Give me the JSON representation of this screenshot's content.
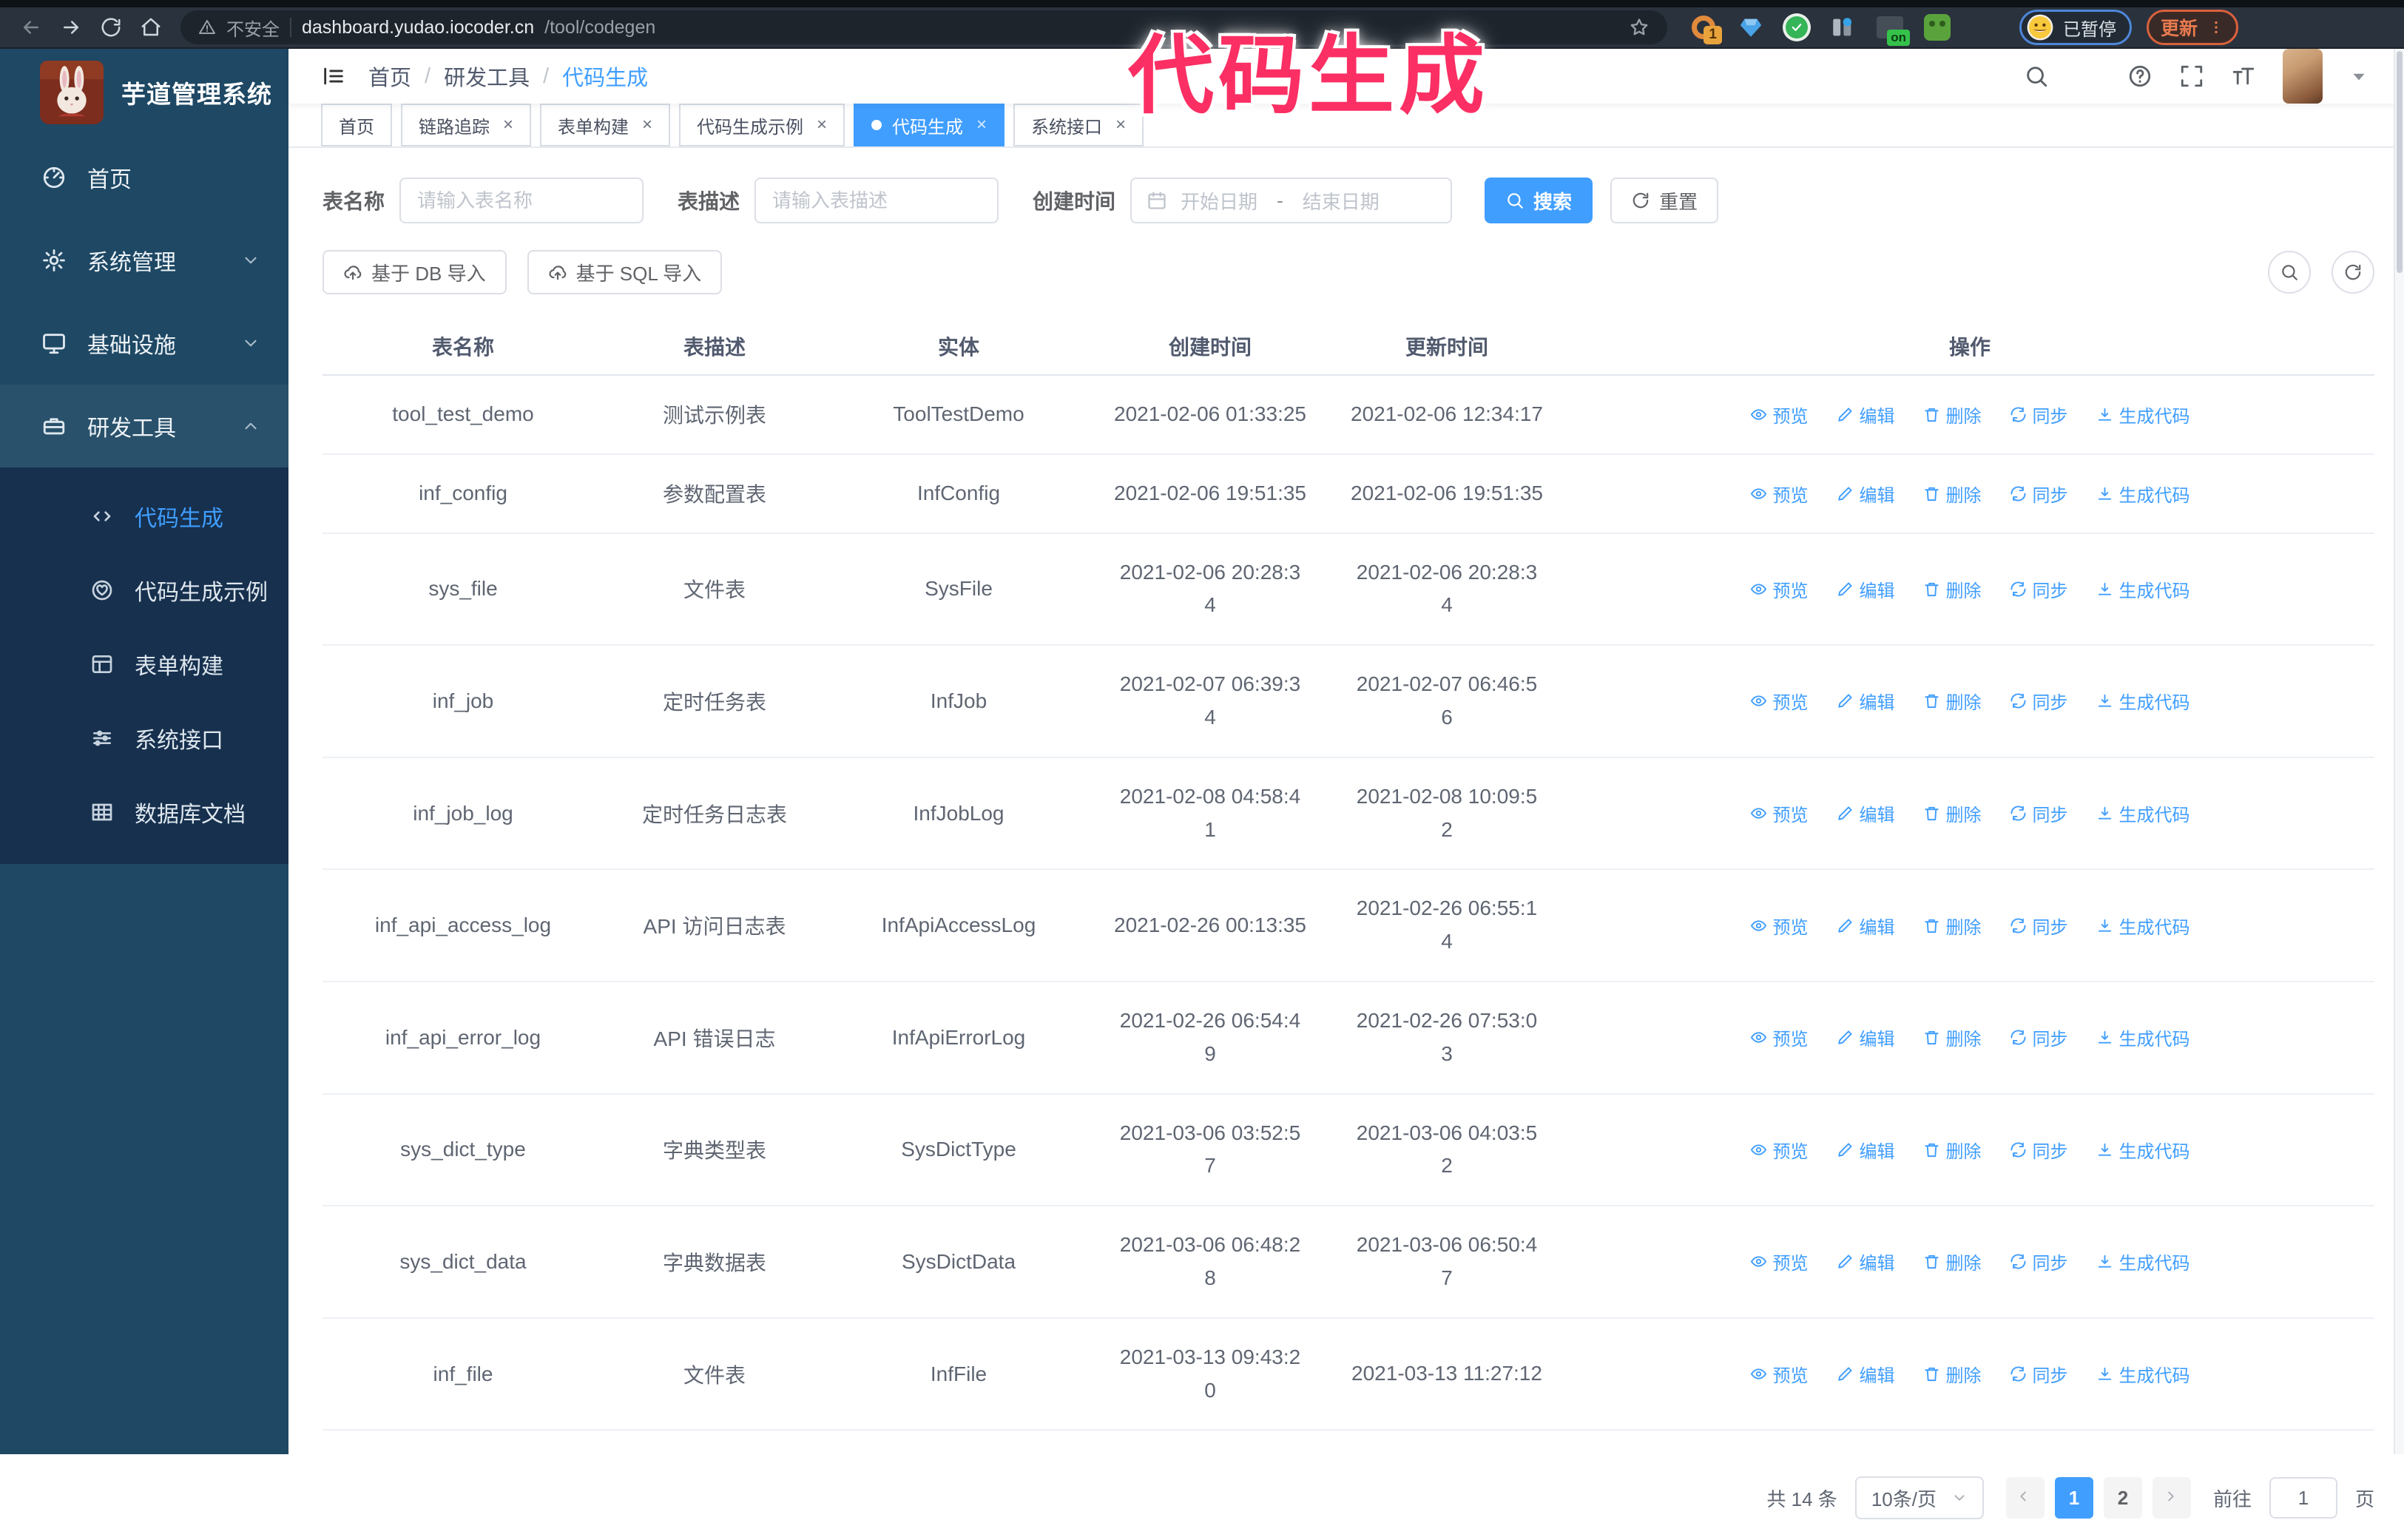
{
  "annotation": {
    "text": "代码生成",
    "color": "#fb2f63"
  },
  "browser": {
    "insecure": "不安全",
    "host": "dashboard.yudao.iocoder.cn",
    "path": "/tool/codegen",
    "extensions_badge": "1",
    "on_badge": "on",
    "paused": "已暂停",
    "update": "更新",
    "icons": [
      "back-icon",
      "forward-icon",
      "reload-icon",
      "home-icon",
      "warning-icon",
      "bookmark-star-icon",
      "dots-vertical-icon"
    ]
  },
  "colors": {
    "primary": "#409eff",
    "sidebar": "#1e4864",
    "submenu": "#16304f",
    "link": "#409eff"
  },
  "app": {
    "logo_title": "芋道管理系统",
    "breadcrumb": [
      "首页",
      "研发工具",
      "代码生成"
    ],
    "header_icons": [
      "search-icon",
      "github-icon",
      "help-icon",
      "fullscreen-icon",
      "font-size-icon",
      "avatar",
      "caret-down-icon"
    ],
    "sidebar": {
      "items": [
        {
          "label": "首页",
          "icon": "dashboard-icon"
        },
        {
          "label": "系统管理",
          "icon": "gear-icon",
          "chevron": "down"
        },
        {
          "label": "基础设施",
          "icon": "monitor-icon",
          "chevron": "down"
        },
        {
          "label": "研发工具",
          "icon": "toolbox-icon",
          "chevron": "up",
          "expanded": true
        }
      ],
      "submenu": [
        {
          "label": "代码生成",
          "icon": "code-icon",
          "active": true
        },
        {
          "label": "代码生成示例",
          "icon": "example-icon"
        },
        {
          "label": "表单构建",
          "icon": "form-icon"
        },
        {
          "label": "系统接口",
          "icon": "api-icon"
        },
        {
          "label": "数据库文档",
          "icon": "database-icon"
        }
      ]
    },
    "tabs": [
      {
        "label": "首页",
        "closable": false,
        "active": false
      },
      {
        "label": "链路追踪",
        "closable": true,
        "active": false
      },
      {
        "label": "表单构建",
        "closable": true,
        "active": false
      },
      {
        "label": "代码生成示例",
        "closable": true,
        "active": false
      },
      {
        "label": "代码生成",
        "closable": true,
        "active": true
      },
      {
        "label": "系统接口",
        "closable": true,
        "active": false
      }
    ],
    "filters": {
      "name_label": "表名称",
      "name_placeholder": "请输入表名称",
      "desc_label": "表描述",
      "desc_placeholder": "请输入表描述",
      "time_label": "创建时间",
      "start_placeholder": "开始日期",
      "range_separator": "-",
      "end_placeholder": "结束日期",
      "search": "搜索",
      "reset": "重置"
    },
    "toolbar": {
      "db_import": "基于 DB 导入",
      "sql_import": "基于 SQL 导入",
      "mini_icons": [
        "search-icon",
        "refresh-icon"
      ]
    },
    "table": {
      "columns": [
        "表名称",
        "表描述",
        "实体",
        "创建时间",
        "更新时间",
        "操作"
      ],
      "row_actions": [
        "预览",
        "编辑",
        "删除",
        "同步",
        "生成代码"
      ],
      "row_action_icons": [
        "eye-icon",
        "edit-icon",
        "trash-icon",
        "sync-icon",
        "download-icon"
      ],
      "rows": [
        {
          "name": "tool_test_demo",
          "desc": "测试示例表",
          "entity": "ToolTestDemo",
          "created": "2021-02-06 01:33:25",
          "updated": "2021-02-06 12:34:17"
        },
        {
          "name": "inf_config",
          "desc": "参数配置表",
          "entity": "InfConfig",
          "created": "2021-02-06 19:51:35",
          "updated": "2021-02-06 19:51:35"
        },
        {
          "name": "sys_file",
          "desc": "文件表",
          "entity": "SysFile",
          "created": "2021-02-06 20:28:3\n4",
          "updated": "2021-02-06 20:28:3\n4"
        },
        {
          "name": "inf_job",
          "desc": "定时任务表",
          "entity": "InfJob",
          "created": "2021-02-07 06:39:3\n4",
          "updated": "2021-02-07 06:46:5\n6"
        },
        {
          "name": "inf_job_log",
          "desc": "定时任务日志表",
          "entity": "InfJobLog",
          "created": "2021-02-08 04:58:4\n1",
          "updated": "2021-02-08 10:09:5\n2"
        },
        {
          "name": "inf_api_access_log",
          "desc": "API 访问日志表",
          "entity": "InfApiAccessLog",
          "created": "2021-02-26 00:13:35",
          "updated": "2021-02-26 06:55:1\n4"
        },
        {
          "name": "inf_api_error_log",
          "desc": "API 错误日志",
          "entity": "InfApiErrorLog",
          "created": "2021-02-26 06:54:4\n9",
          "updated": "2021-02-26 07:53:0\n3"
        },
        {
          "name": "sys_dict_type",
          "desc": "字典类型表",
          "entity": "SysDictType",
          "created": "2021-03-06 03:52:5\n7",
          "updated": "2021-03-06 04:03:5\n2"
        },
        {
          "name": "sys_dict_data",
          "desc": "字典数据表",
          "entity": "SysDictData",
          "created": "2021-03-06 06:48:2\n8",
          "updated": "2021-03-06 06:50:4\n7"
        },
        {
          "name": "inf_file",
          "desc": "文件表",
          "entity": "InfFile",
          "created": "2021-03-13 09:43:2\n0",
          "updated": "2021-03-13 11:27:12"
        }
      ]
    },
    "pagination": {
      "total": "共 14 条",
      "page_size": "10条/页",
      "pages": [
        "1",
        "2"
      ],
      "active_page": "1",
      "goto": "前往",
      "goto_value": "1",
      "unit": "页"
    }
  }
}
